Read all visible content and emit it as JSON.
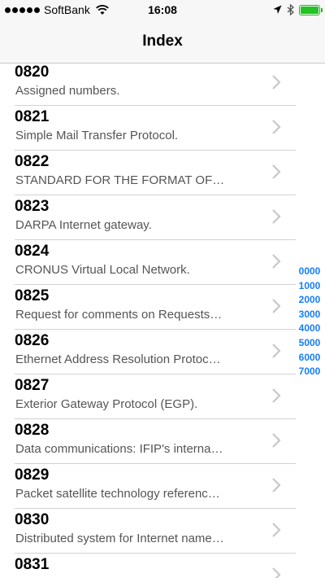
{
  "status_bar": {
    "carrier": "SoftBank",
    "time": "16:08",
    "battery_level": 1.0,
    "battery_color": "#22c322"
  },
  "nav": {
    "title": "Index"
  },
  "rows": [
    {
      "number": "0820",
      "title": "Assigned numbers."
    },
    {
      "number": "0821",
      "title": "Simple Mail Transfer Protocol."
    },
    {
      "number": "0822",
      "title": "STANDARD FOR THE FORMAT OF…"
    },
    {
      "number": "0823",
      "title": "DARPA Internet gateway."
    },
    {
      "number": "0824",
      "title": "CRONUS Virtual Local Network."
    },
    {
      "number": "0825",
      "title": "Request for comments on Requests…"
    },
    {
      "number": "0826",
      "title": "Ethernet Address Resolution Protoc…"
    },
    {
      "number": "0827",
      "title": "Exterior Gateway Protocol (EGP)."
    },
    {
      "number": "0828",
      "title": "Data communications: IFIP's interna…"
    },
    {
      "number": "0829",
      "title": "Packet satellite technology referenc…"
    },
    {
      "number": "0830",
      "title": "Distributed system for Internet name…"
    },
    {
      "number": "0831",
      "title": ""
    }
  ],
  "section_index": [
    "0000",
    "1000",
    "2000",
    "3000",
    "4000",
    "5000",
    "6000",
    "7000"
  ],
  "colors": {
    "accent": "#157efb",
    "chevron": "#c7c7cc"
  }
}
